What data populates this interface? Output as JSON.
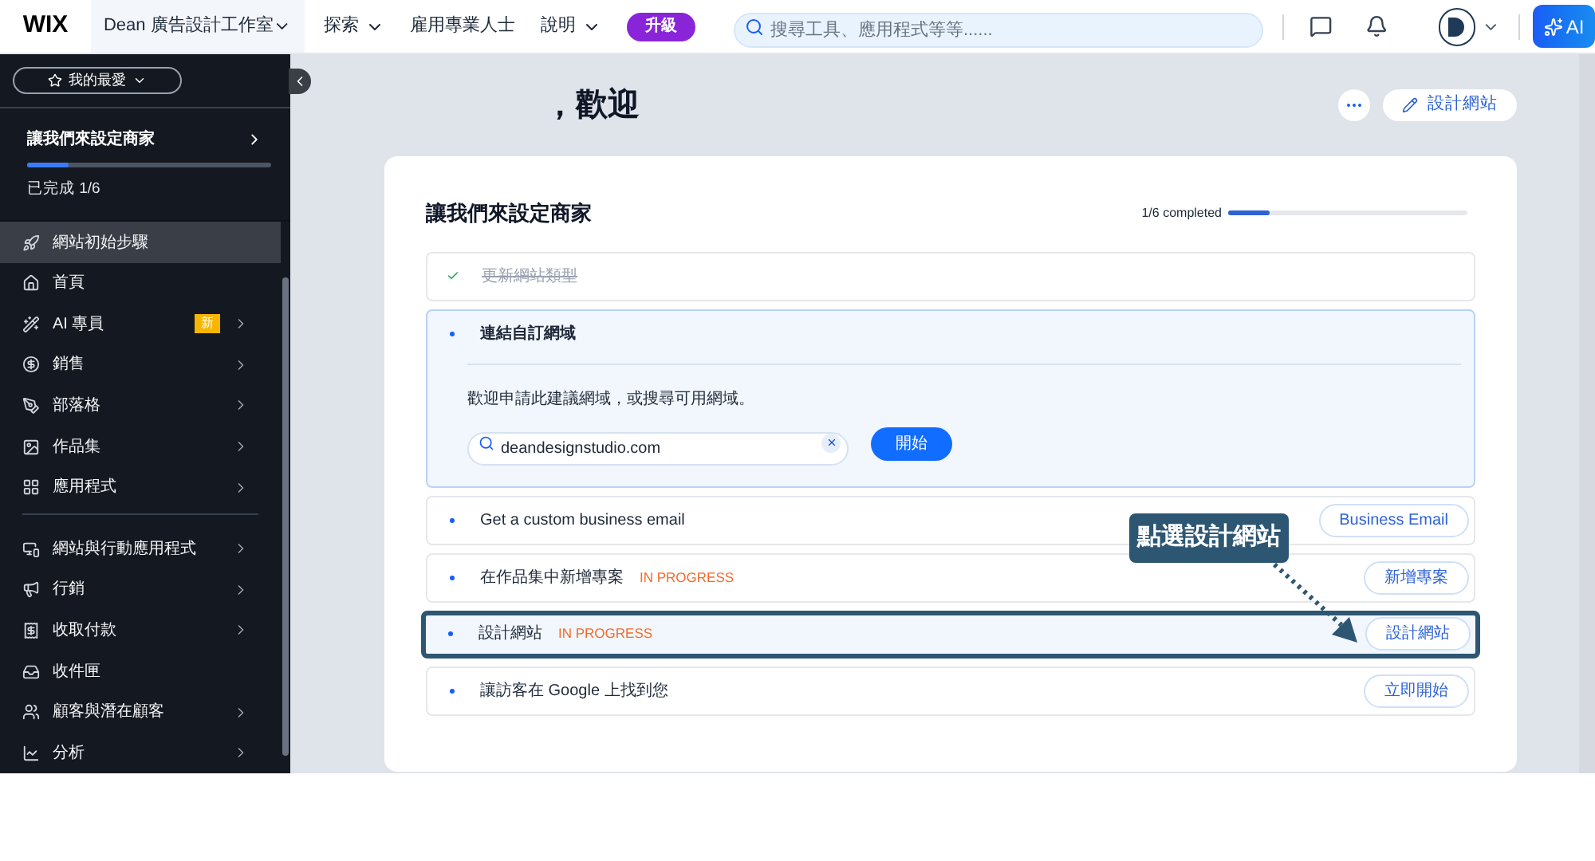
{
  "topbar": {
    "logo": "WIX",
    "site": "Dean 廣告設計工作室",
    "nav": [
      {
        "label": "探索",
        "dropdown": true
      },
      {
        "label": "雇用專業人士",
        "dropdown": false
      },
      {
        "label": "說明",
        "dropdown": true
      }
    ],
    "upgrade": "升級",
    "search": {
      "placeholder": "搜尋工具、應用程式等等......"
    },
    "ai": "AI"
  },
  "sidebar": {
    "favorites": "我的最愛",
    "setup": {
      "title": "讓我們來設定商家",
      "level": 0.17,
      "progress": "已完成 1/6"
    },
    "groups": [
      [
        {
          "label": "網站初始步驟",
          "selected": true,
          "submenu": false
        },
        {
          "label": "首頁",
          "selected": false,
          "submenu": false
        },
        {
          "label": "AI 專員",
          "selected": false,
          "submenu": true,
          "badge": "新"
        },
        {
          "label": "銷售",
          "selected": false,
          "submenu": true
        },
        {
          "label": "部落格",
          "selected": false,
          "submenu": true
        },
        {
          "label": "作品集",
          "selected": false,
          "submenu": true
        },
        {
          "label": "應用程式",
          "selected": false,
          "submenu": true
        }
      ],
      [
        {
          "label": "網站與行動應用程式",
          "selected": false,
          "submenu": true
        },
        {
          "label": "行銷",
          "selected": false,
          "submenu": true
        },
        {
          "label": "收取付款",
          "selected": false,
          "submenu": true
        },
        {
          "label": "收件匣",
          "selected": false,
          "submenu": false
        },
        {
          "label": "顧客與潛在顧客",
          "selected": false,
          "submenu": true
        },
        {
          "label": "分析",
          "selected": false,
          "submenu": true
        }
      ]
    ]
  },
  "main": {
    "greeting": "，歡迎",
    "design_button": "設計網站",
    "card": {
      "title": "讓我們來設定商家",
      "progress": {
        "text": "1/6 completed",
        "level": 0.17
      },
      "steps": [
        {
          "title": "更新網站類型",
          "done": true,
          "expanded": false,
          "highlighted": false
        },
        {
          "title": "連結自訂網域",
          "done": false,
          "expanded": true,
          "highlighted": false,
          "description": "歡迎申請此建議網域，或搜尋可用網域。",
          "field": "deandesignstudio.com",
          "action": "開始"
        },
        {
          "title": "Get a custom business email",
          "done": false,
          "expanded": false,
          "highlighted": false,
          "button": "Business Email"
        },
        {
          "title": "在作品集中新增專案",
          "done": false,
          "expanded": false,
          "highlighted": false,
          "tag": "IN PROGRESS",
          "button": "新增專案"
        },
        {
          "title": "設計網站",
          "done": false,
          "expanded": false,
          "highlighted": true,
          "tag": "IN PROGRESS",
          "button": "設計網站"
        },
        {
          "title": "讓訪客在 Google 上找到您",
          "done": false,
          "expanded": false,
          "highlighted": false,
          "button": "立即開始"
        }
      ]
    },
    "annotation": {
      "label": "點選設計網站"
    }
  }
}
